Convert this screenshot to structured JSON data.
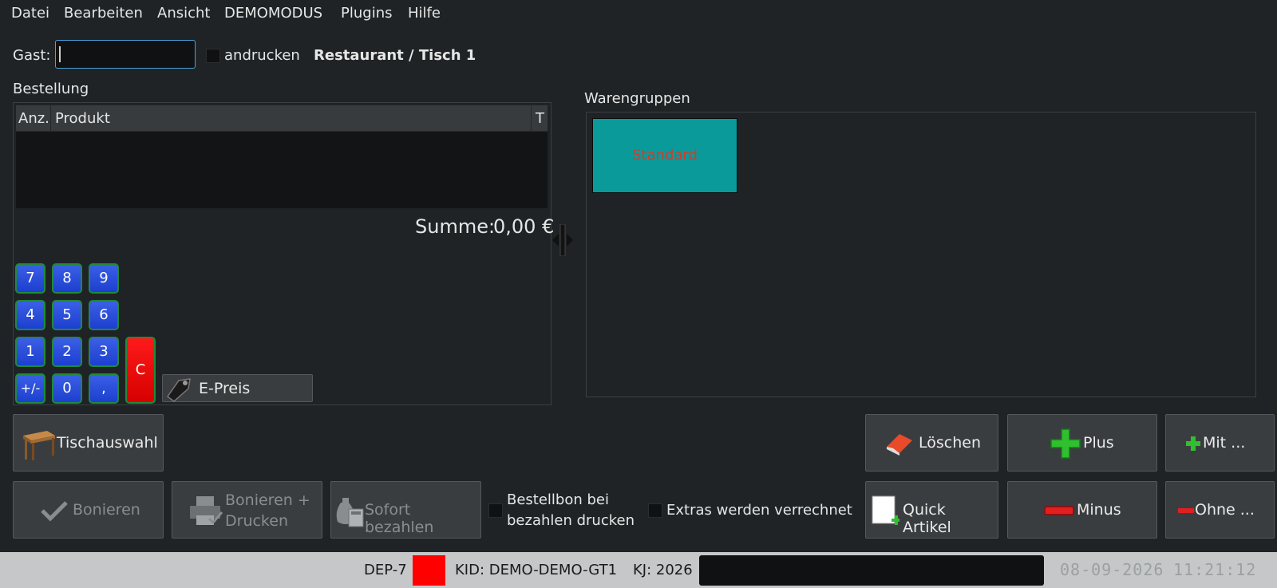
{
  "menu": {
    "items": [
      "Datei",
      "Bearbeiten",
      "Ansicht",
      "DEMOMODUS",
      "Plugins",
      "Hilfe"
    ]
  },
  "header": {
    "guest_label": "Gast:",
    "guest_value": "",
    "print_label": "andrucken",
    "location": "Restaurant / Tisch 1"
  },
  "order": {
    "section_title": "Bestellung",
    "columns": [
      "Anz.",
      "Produkt",
      "T"
    ],
    "sum_label": "Summe:",
    "sum_value": "0,00 €"
  },
  "keypad": {
    "keys": [
      "7",
      "8",
      "9",
      "4",
      "5",
      "6",
      "1",
      "2",
      "3",
      "+/-",
      "0",
      ","
    ],
    "clear": "C",
    "eprice": "E-Preis"
  },
  "groups": {
    "section_title": "Warengruppen",
    "items": [
      "Standard"
    ]
  },
  "actions": {
    "table_select": "Tischauswahl",
    "delete": "Löschen",
    "plus": "Plus",
    "with": "Mit ...",
    "book": "Bonieren",
    "book_print_1": "Bonieren +",
    "book_print_2": "Drucken",
    "pay_now": "Sofort bezahlen",
    "receipt_print_1": "Bestellbon bei",
    "receipt_print_2": "bezahlen drucken",
    "extras": "Extras werden verrechnet",
    "quick": "Quick Artikel",
    "minus": "Minus",
    "without": "Ohne ..."
  },
  "status": {
    "dep": "DEP-7",
    "indicator_color": "#ff0000",
    "kid": "KID: DEMO-DEMO-GT1",
    "kj": "KJ: 2026",
    "date": "08-09-2026",
    "time": "11:21:12"
  },
  "colors": {
    "background": "#1f2326",
    "keypad_blue": "#2a4ee0",
    "clear_red": "#e00000",
    "group_teal": "#0b9a9a",
    "focus_blue": "#4aa3df"
  }
}
